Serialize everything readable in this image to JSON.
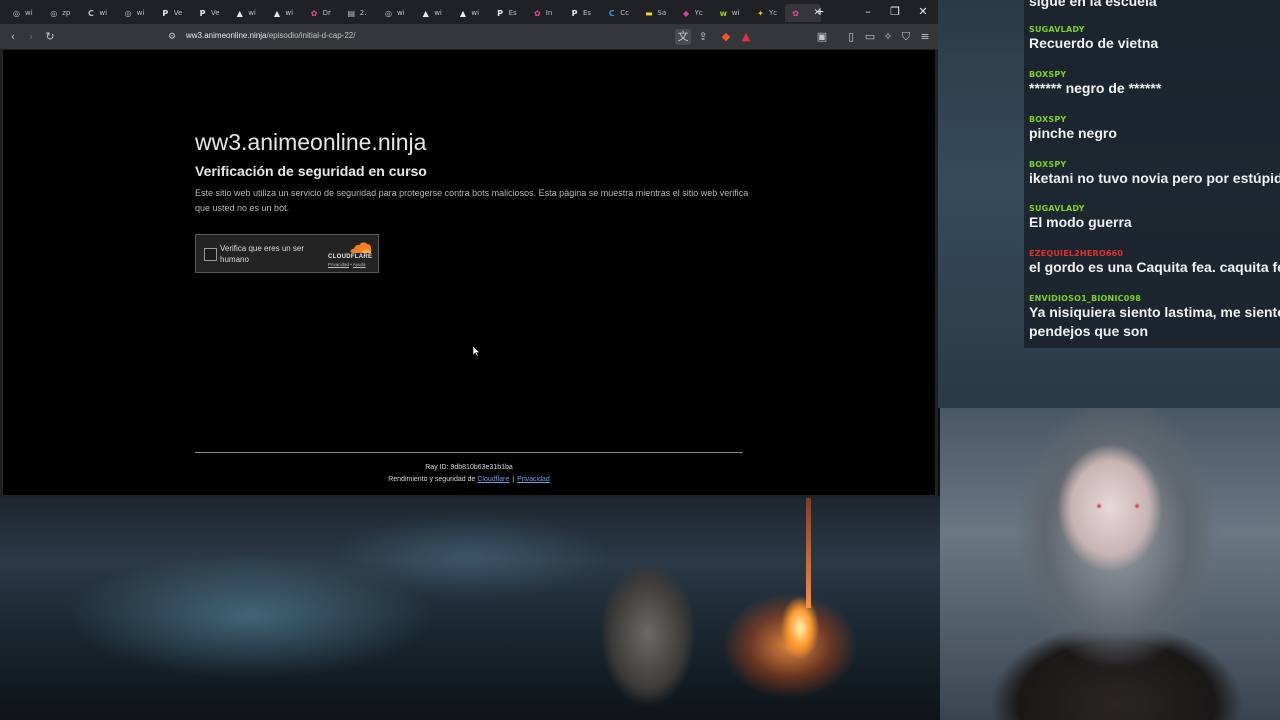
{
  "browser": {
    "tabs": [
      {
        "icon": "globe-icon",
        "label": "wi",
        "color": "#bdc1c6"
      },
      {
        "icon": "globe-icon",
        "label": "zp",
        "color": "#bdc1c6"
      },
      {
        "icon": "c-logo-icon",
        "label": "wi",
        "color": "#bdc1c6"
      },
      {
        "icon": "globe-icon",
        "label": "wi",
        "color": "#bdc1c6"
      },
      {
        "icon": "p-logo-icon",
        "label": "Ve",
        "color": "#e8eaed"
      },
      {
        "icon": "p-logo-icon",
        "label": "Ve",
        "color": "#e8eaed"
      },
      {
        "icon": "triangle-icon",
        "label": "wi",
        "color": "#e8eaed"
      },
      {
        "icon": "triangle-icon",
        "label": "wi",
        "color": "#e8eaed"
      },
      {
        "icon": "anime-icon",
        "label": "Dr",
        "color": "#e24aa0"
      },
      {
        "icon": "doc-icon",
        "label": "2.",
        "color": "#bdc1c6"
      },
      {
        "icon": "globe-icon",
        "label": "wi",
        "color": "#bdc1c6"
      },
      {
        "icon": "triangle-icon",
        "label": "wi",
        "color": "#e8eaed"
      },
      {
        "icon": "triangle-icon",
        "label": "wi",
        "color": "#e8eaed"
      },
      {
        "icon": "p-circle-icon",
        "label": "Es",
        "color": "#e8eaed"
      },
      {
        "icon": "anime-icon",
        "label": "In",
        "color": "#e24aa0"
      },
      {
        "icon": "p-logo-icon",
        "label": "Es",
        "color": "#e8eaed"
      },
      {
        "icon": "c-logo-icon",
        "label": "Cc",
        "color": "#4a8af4"
      },
      {
        "icon": "note-icon",
        "label": "Sa",
        "color": "#f2d23a"
      },
      {
        "icon": "twitch-icon",
        "label": "Yc",
        "color": "#e040a0"
      },
      {
        "icon": "w-logo-icon",
        "label": "wi",
        "color": "#9ad028"
      },
      {
        "icon": "blade-icon",
        "label": "Yc",
        "color": "#e8c020"
      },
      {
        "icon": "anime-icon",
        "label": "",
        "color": "#e24aa0"
      }
    ],
    "url_host": "ww3.animeonline.ninja",
    "url_path": "/episodio/initial-d-cap-22/"
  },
  "page": {
    "site_title": "ww3.animeonline.ninja",
    "heading": "Verificación de seguridad en curso",
    "description": "Este sitio web utiliza un servicio de seguridad para protegerse contra bots maliciosos. Esta página se muestra mientras el sitio web verifica que usted no es un bot.",
    "captcha": {
      "label": "Verifica que eres un ser humano",
      "brand": "CLOUDFLARE",
      "privacy_link": "Privacidad",
      "sep": "•",
      "help_link": "Ayuda",
      "brand_color": "#f38020"
    },
    "footer": {
      "ray_id": "Ray ID: 9db810b63e31b1ba",
      "perf_prefix": "Rendimiento y seguridad de",
      "cloudflare_link": "Cloudflare",
      "divider": "|",
      "privacy_link": "Privacidad"
    }
  },
  "chat": {
    "top_partial": "sigue en la escuela",
    "messages": [
      {
        "user": "SUGAVLADY",
        "user_color": "#7ed321",
        "text": "Recuerdo de vietna"
      },
      {
        "user": "BOXSPY",
        "user_color": "#7ed321",
        "text": "****** negro de ******"
      },
      {
        "user": "BOXSPY",
        "user_color": "#7ed321",
        "text": "pinche negro"
      },
      {
        "user": "BOXSPY",
        "user_color": "#7ed321",
        "text": "iketani no tuvo novia pero por estúpido"
      },
      {
        "user": "SUGAVLADY",
        "user_color": "#7ed321",
        "text": "El modo guerra"
      },
      {
        "user": "EZEQUIEL2HERO660",
        "user_color": "#e0302c",
        "text": "el gordo es una Caquita fea. caquita fea"
      },
      {
        "user": "ENVIDIOSO1_BIONIC098",
        "user_color": "#7ed321",
        "text": "Ya nisiquiera siento lastima, me siento m",
        "text2": "pendejos que son"
      }
    ]
  }
}
